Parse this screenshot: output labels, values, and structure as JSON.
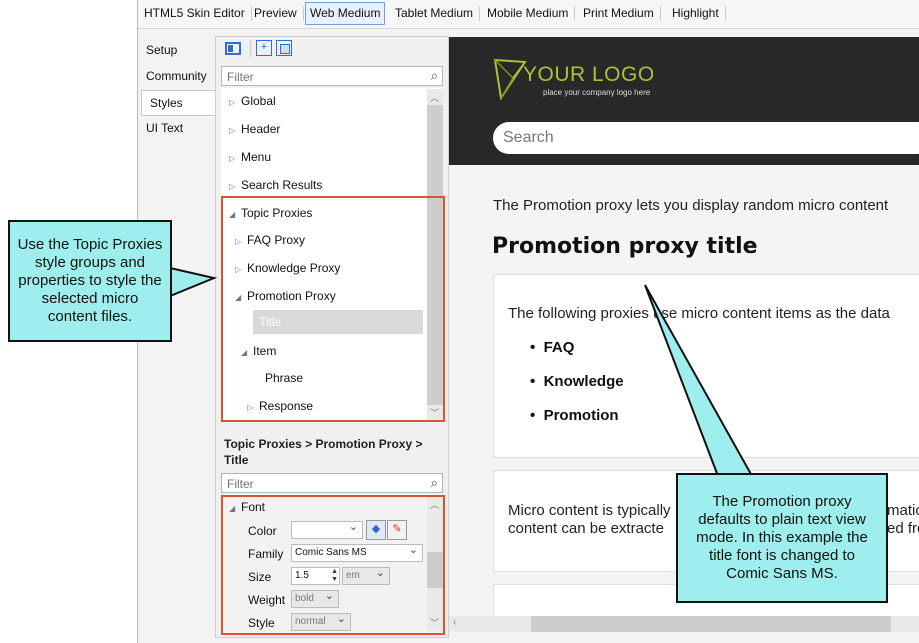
{
  "toolbar": {
    "tabs": [
      "HTML5 Skin Editor",
      "Preview",
      "Web Medium",
      "Tablet Medium",
      "Mobile Medium",
      "Print Medium",
      "Highlight"
    ]
  },
  "side_tabs": [
    "Setup",
    "Community",
    "Styles",
    "UI Text"
  ],
  "styles_panel": {
    "filter_placeholder": "Filter",
    "tree": [
      "Global",
      "Header",
      "Menu",
      "Search Results",
      "Topic Proxies",
      "FAQ Proxy",
      "Knowledge Proxy",
      "Promotion Proxy",
      "Title",
      "Item",
      "Phrase",
      "Response"
    ],
    "breadcrumb": "Topic Proxies > Promotion Proxy > Title",
    "props_filter_placeholder": "Filter",
    "props": {
      "group": "Font",
      "color_label": "Color",
      "family_label": "Family",
      "family_value": "Comic Sans MS",
      "size_label": "Size",
      "size_value": "1.5",
      "size_unit": "em",
      "weight_label": "Weight",
      "weight_value": "bold",
      "style_label": "Style",
      "style_value": "normal"
    }
  },
  "preview": {
    "logo_text": "YOUR LOGO",
    "logo_tagline": "place your company logo here",
    "search_placeholder": "Search",
    "intro": "The Promotion proxy lets you display random micro content",
    "title": "Promotion proxy title",
    "card1_text": "The following proxies use micro content items as the data",
    "bullets": [
      "FAQ",
      "Knowledge",
      "Promotion"
    ],
    "card2_line1": "Micro content is typically",
    "card2_line1_tail": "matio",
    "card2_line2": "content can be extracte",
    "card2_line2_tail": "ed fro"
  },
  "callouts": {
    "left": "Use the Topic Proxies style groups and properties to style the selected micro content files.",
    "right": "The Promotion proxy defaults to plain text view mode. In this example the title font is changed to Comic Sans MS."
  },
  "colors": {
    "accent_red": "#d9542f",
    "callout_fill": "#9eeeed",
    "header_dark": "#282828",
    "logo_green": "#a8c23a"
  }
}
